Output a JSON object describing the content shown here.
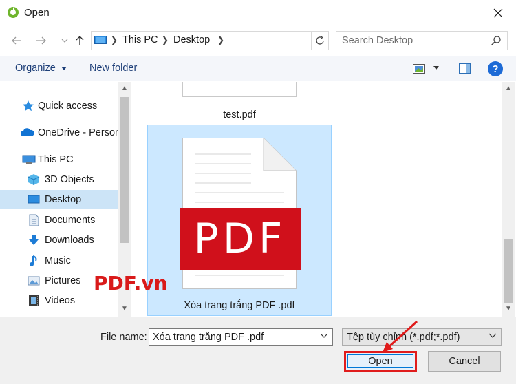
{
  "window": {
    "title": "Open",
    "close_label": "✕"
  },
  "address": {
    "crumbs": [
      "This PC",
      "Desktop"
    ]
  },
  "search": {
    "placeholder": "Search Desktop"
  },
  "toolbar": {
    "organize": "Organize",
    "new_folder": "New folder",
    "help": "?"
  },
  "nav": {
    "items": [
      {
        "label": "Quick access",
        "icon": "star-icon"
      },
      {
        "label": "OneDrive - Person",
        "icon": "cloud-icon"
      },
      {
        "label": "This PC",
        "icon": "computer-icon"
      },
      {
        "label": "3D Objects",
        "icon": "cube-icon"
      },
      {
        "label": "Desktop",
        "icon": "desktop-icon",
        "selected": true
      },
      {
        "label": "Documents",
        "icon": "document-icon"
      },
      {
        "label": "Downloads",
        "icon": "download-icon"
      },
      {
        "label": "Music",
        "icon": "music-icon"
      },
      {
        "label": "Pictures",
        "icon": "picture-icon"
      },
      {
        "label": "Videos",
        "icon": "video-icon"
      }
    ]
  },
  "files": {
    "items": [
      {
        "name": "test.pdf"
      },
      {
        "name": "Xóa trang trắng PDF .pdf",
        "selected": true,
        "badge": "PDF"
      }
    ]
  },
  "watermark": "PDF.vn",
  "footer": {
    "file_name_label": "File name:",
    "file_name_value": "Xóa trang trắng PDF .pdf",
    "filter_value": "Tệp tùy chỉnh (*.pdf;*.pdf)",
    "open_label": "Open",
    "cancel_label": "Cancel"
  },
  "colors": {
    "accent": "#0078d7",
    "selection": "#cce8ff",
    "highlight_red": "#e01c1c",
    "pdf_red": "#d0101b"
  }
}
